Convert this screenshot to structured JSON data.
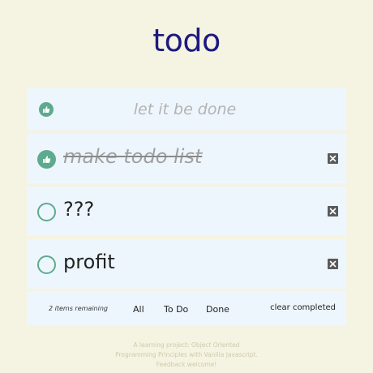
{
  "header": {
    "title": "todo"
  },
  "new_todo": {
    "placeholder": "let it be done",
    "toggle_icon": "thumbs-up-icon"
  },
  "todos": [
    {
      "label": "make todo list",
      "completed": true
    },
    {
      "label": "???",
      "completed": false
    },
    {
      "label": "profit",
      "completed": false
    }
  ],
  "footer": {
    "remaining": "2 items remaining",
    "filters": [
      "All",
      "To Do",
      "Done"
    ],
    "clear_label": "clear completed"
  },
  "info": {
    "text": "A learning project: Object Oriented Programming Principles with Vanilla Javascript. Feedback welcome!"
  },
  "colors": {
    "background": "#f5f3e1",
    "panel": "#eef6fd",
    "accent": "#5eaa8f",
    "title": "#1c1a7e"
  }
}
